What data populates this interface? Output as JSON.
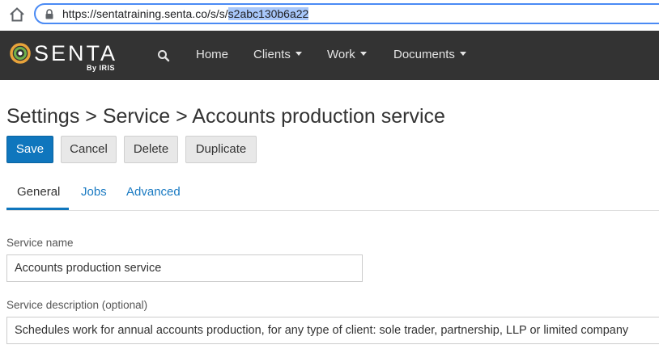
{
  "browser": {
    "url_base": "https://sentatraining.senta.co/s/s/",
    "url_selected": "s2abc130b6a22"
  },
  "app": {
    "logo_text": "SENTA",
    "logo_sub": "By IRIS"
  },
  "nav": {
    "items": [
      {
        "label": "Home",
        "dropdown": false
      },
      {
        "label": "Clients",
        "dropdown": true
      },
      {
        "label": "Work",
        "dropdown": true
      },
      {
        "label": "Documents",
        "dropdown": true
      }
    ]
  },
  "page": {
    "title": "Settings > Service > Accounts production service"
  },
  "toolbar": {
    "save_label": "Save",
    "cancel_label": "Cancel",
    "delete_label": "Delete",
    "duplicate_label": "Duplicate"
  },
  "tabs": [
    {
      "label": "General",
      "active": true
    },
    {
      "label": "Jobs",
      "active": false
    },
    {
      "label": "Advanced",
      "active": false
    }
  ],
  "form": {
    "service_name_label": "Service name",
    "service_name_value": "Accounts production service",
    "service_description_label": "Service description (optional)",
    "service_description_value": "Schedules work for annual accounts production, for any type of client: sole trader, partnership, LLP or limited company"
  },
  "colors": {
    "navbar_bg": "#333333",
    "primary": "#0f76bd",
    "link": "#1a7ac2",
    "logo_ring_outer": "#e8a33a",
    "logo_ring_inner": "#6fb04b"
  }
}
